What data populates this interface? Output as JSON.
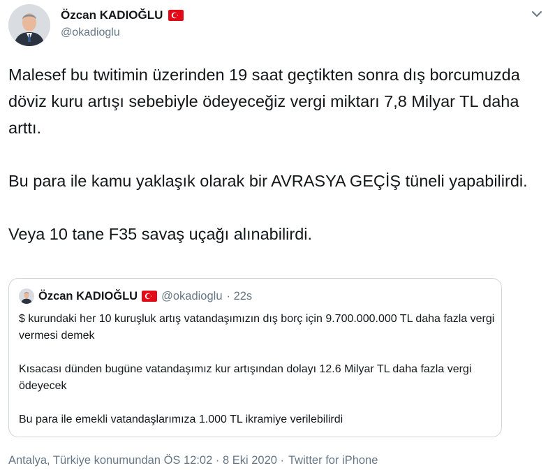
{
  "author": {
    "name": "Özcan KADIOĞLU",
    "handle": "@okadioglu",
    "flag_icon": "turkey-flag-icon"
  },
  "tweet": {
    "paragraphs": [
      "Malesef bu twitimin üzerinden 19 saat geçtikten sonra dış borcumuzda döviz kuru artışı sebebiyle ödeyeceğiz vergi miktarı 7,8 Milyar TL daha arttı.",
      "Bu para ile kamu yaklaşık olarak  bir AVRASYA GEÇİŞ tüneli yapabilirdi.",
      "Veya 10 tane F35 savaş uçağı alınabilirdi."
    ]
  },
  "quoted_tweet": {
    "name": "Özcan KADIOĞLU",
    "handle": "@okadioglu",
    "time": "· 22s",
    "paragraphs": [
      "$ kurundaki her 10 kuruşluk artış vatandaşımızın dış borç için 9.700.000.000 TL daha fazla vergi vermesi demek",
      "Kısacası dünden bugüne vatandaşımız kur artışından dolayı 12.6 Milyar  TL daha fazla vergi ödeyecek",
      "Bu para ile emekli vatandaşlarımıza 1.000 TL ikramiye verilebilirdi"
    ]
  },
  "meta": {
    "location_time": "Antalya, Türkiye konumundan ÖS 12:02 · 8 Eki 2020 ·",
    "source": "Twitter for iPhone"
  },
  "colors": {
    "text": "#14171a",
    "secondary": "#657786",
    "border": "#ccd6dd",
    "flag_red": "#e30a17"
  }
}
